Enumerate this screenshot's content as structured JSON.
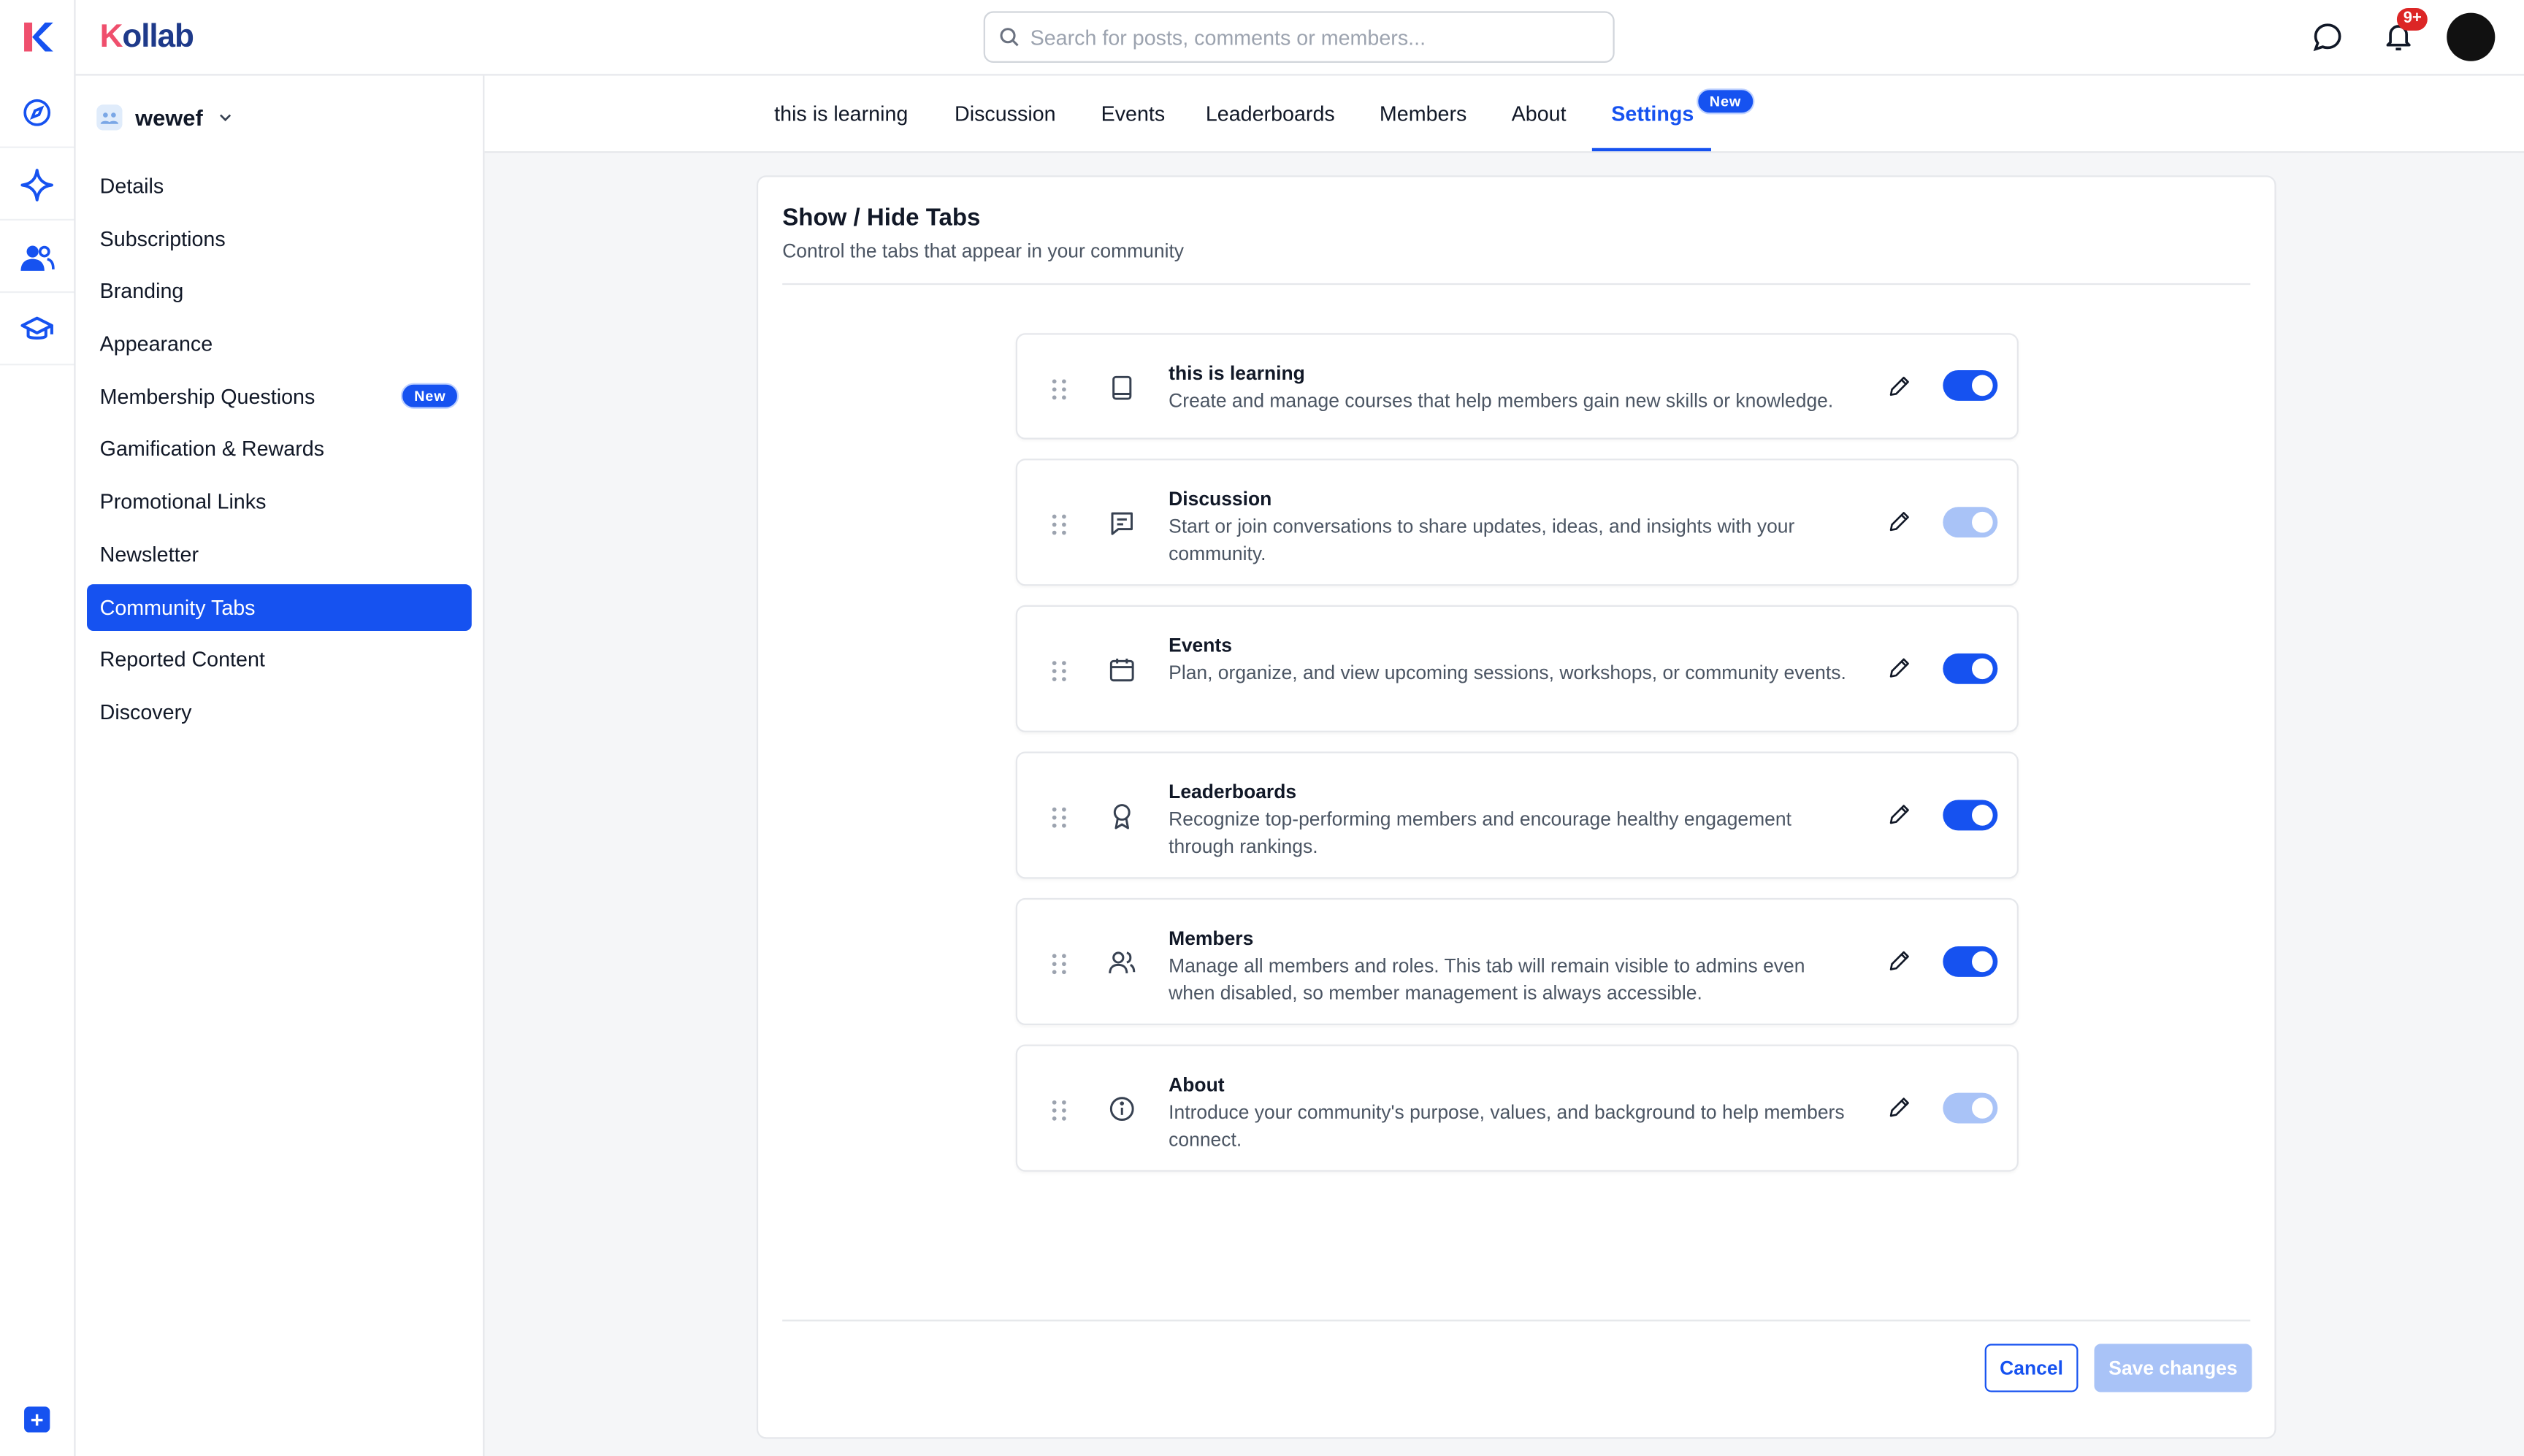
{
  "app": {
    "brand_prefix": "K",
    "brand_rest": "ollab"
  },
  "search": {
    "placeholder": "Search for posts, comments or members..."
  },
  "header": {
    "notification_count": "9+"
  },
  "community": {
    "name": "wewef"
  },
  "sidebar": {
    "items": [
      {
        "label": "Details"
      },
      {
        "label": "Subscriptions"
      },
      {
        "label": "Branding"
      },
      {
        "label": "Appearance"
      },
      {
        "label": "Membership Questions",
        "badge": "New"
      },
      {
        "label": "Gamification & Rewards"
      },
      {
        "label": "Promotional Links"
      },
      {
        "label": "Newsletter"
      },
      {
        "label": "Community Tabs",
        "active": true
      },
      {
        "label": "Reported Content"
      },
      {
        "label": "Discovery"
      }
    ]
  },
  "tabs": {
    "items": [
      {
        "label": "this is learning"
      },
      {
        "label": "Discussion"
      },
      {
        "label": "Events"
      },
      {
        "label": "Leaderboards"
      },
      {
        "label": "Members"
      },
      {
        "label": "About"
      },
      {
        "label": "Settings",
        "active": true,
        "badge": "New"
      }
    ]
  },
  "panel": {
    "title": "Show / Hide Tabs",
    "subtitle": "Control the tabs that appear in your community",
    "cards": [
      {
        "title": "this is learning",
        "desc": "Create and manage courses that help members gain new skills or knowledge.",
        "icon": "book-icon",
        "enabled": true
      },
      {
        "title": "Discussion",
        "desc": "Start or join conversations to share updates, ideas, and insights with your community.",
        "icon": "chat-icon",
        "enabled": false
      },
      {
        "title": "Events",
        "desc": "Plan, organize, and view upcoming sessions, workshops, or community events.",
        "icon": "calendar-icon",
        "enabled": true
      },
      {
        "title": "Leaderboards",
        "desc": "Recognize top-performing members and encourage healthy engagement through rankings.",
        "icon": "award-icon",
        "enabled": true
      },
      {
        "title": "Members",
        "desc": "Manage all members and roles. This tab will remain visible to admins even when disabled, so member management is always accessible.",
        "icon": "users-icon",
        "enabled": true
      },
      {
        "title": "About",
        "desc": "Introduce your community's purpose, values, and background to help members connect.",
        "icon": "info-icon",
        "enabled": false
      }
    ],
    "cancel_label": "Cancel",
    "save_label": "Save changes"
  },
  "colors": {
    "accent": "#1652f0",
    "accent_light": "#a9c3f7",
    "brand_pink": "#ef4f6d",
    "danger": "#dc2626"
  }
}
